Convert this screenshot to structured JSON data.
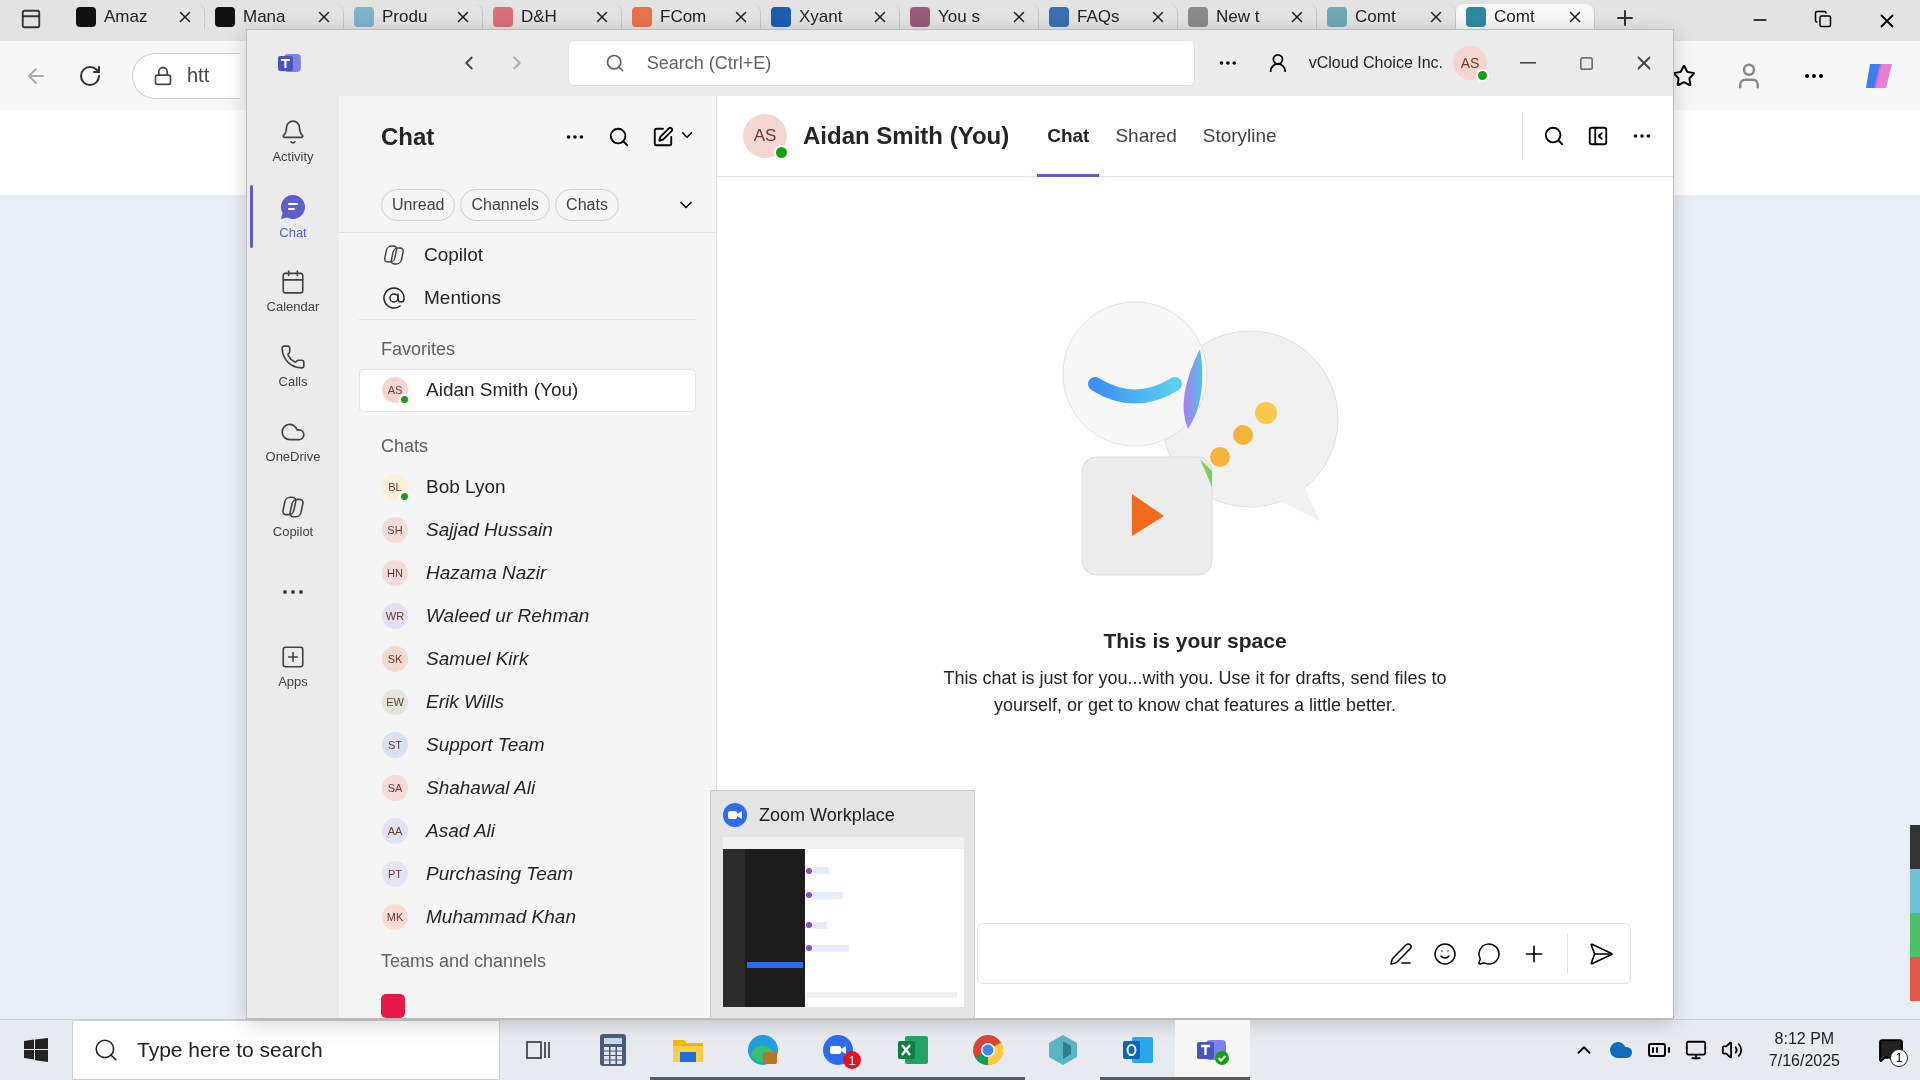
{
  "browser": {
    "tabs": [
      {
        "title": "Amaz",
        "color": "#111111",
        "selected": false
      },
      {
        "title": "Mana",
        "color": "#111111",
        "selected": false
      },
      {
        "title": "Produ",
        "color": "#7fb3c8",
        "selected": false
      },
      {
        "title": "D&H",
        "color": "#d9707a",
        "selected": false
      },
      {
        "title": "FCom",
        "color": "#e8734a",
        "selected": false
      },
      {
        "title": "Xyant",
        "color": "#1a5fb4",
        "selected": false
      },
      {
        "title": "You s",
        "color": "#9a5a7a",
        "selected": false
      },
      {
        "title": "FAQs",
        "color": "#3a70b0",
        "selected": false
      },
      {
        "title": "New t",
        "color": "#8a8a8a",
        "selected": false
      },
      {
        "title": "Comt",
        "color": "#6fa8b8",
        "selected": false
      },
      {
        "title": "Comt",
        "color": "#2f8aa0",
        "selected": true
      }
    ],
    "address": "htt"
  },
  "teams": {
    "title_bar": {
      "search_placeholder": "Search (Ctrl+E)",
      "organization": "vCloud Choice Inc.",
      "avatar": "AS"
    },
    "rail": [
      {
        "kind": "activity",
        "label": "Activity",
        "selected": false
      },
      {
        "kind": "chat",
        "label": "Chat",
        "selected": true
      },
      {
        "kind": "calendar",
        "label": "Calendar",
        "selected": false
      },
      {
        "kind": "calls",
        "label": "Calls",
        "selected": false
      },
      {
        "kind": "onedrive",
        "label": "OneDrive",
        "selected": false
      },
      {
        "kind": "copilot",
        "label": "Copilot",
        "selected": false
      },
      {
        "kind": "more",
        "selected": false
      },
      {
        "kind": "apps",
        "label": "Apps",
        "selected": false
      }
    ],
    "chat_list": {
      "title": "Chat",
      "filters": [
        "Unread",
        "Channels",
        "Chats"
      ],
      "quick_items": [
        {
          "kind": "copilot",
          "label": "Copilot"
        },
        {
          "kind": "mentions",
          "label": "Mentions"
        }
      ],
      "sections": [
        {
          "title": "Favorites",
          "items": [
            {
              "initials": "AS",
              "name": "Aidan Smith (You)",
              "color": "#f3d6cf",
              "online": true,
              "italic": false,
              "selected": true
            }
          ]
        },
        {
          "title": "Chats",
          "items": [
            {
              "initials": "BL",
              "name": "Bob Lyon",
              "color": "#fdefd9",
              "online": true,
              "italic": false,
              "selected": false
            },
            {
              "initials": "SH",
              "name": "Sajjad Hussain",
              "color": "#f5dada",
              "online": false,
              "italic": true,
              "selected": false
            },
            {
              "initials": "HN",
              "name": "Hazama Nazir",
              "color": "#f5dada",
              "online": false,
              "italic": true,
              "selected": false
            },
            {
              "initials": "WR",
              "name": "Waleed ur Rehman",
              "color": "#e1dff2",
              "online": false,
              "italic": true,
              "selected": false
            },
            {
              "initials": "SK",
              "name": "Samuel Kirk",
              "color": "#f5d8cc",
              "online": false,
              "italic": true,
              "selected": false
            },
            {
              "initials": "EW",
              "name": "Erik Wills",
              "color": "#e2e5dc",
              "online": false,
              "italic": true,
              "selected": false
            },
            {
              "initials": "ST",
              "name": "Support Team",
              "color": "#d7e1f3",
              "online": false,
              "italic": true,
              "selected": false
            },
            {
              "initials": "SA",
              "name": "Shahawal Ali",
              "color": "#f5dada",
              "online": false,
              "italic": true,
              "selected": false
            },
            {
              "initials": "AA",
              "name": "Asad Ali",
              "color": "#e3e2f2",
              "online": false,
              "italic": true,
              "selected": false
            },
            {
              "initials": "PT",
              "name": "Purchasing Team",
              "color": "#e6e4f3",
              "online": false,
              "italic": true,
              "selected": false
            },
            {
              "initials": "MK",
              "name": "Muhammad Khan",
              "color": "#fbdcd2",
              "online": false,
              "italic": true,
              "selected": false
            }
          ]
        },
        {
          "title": "Teams and channels",
          "items": [
            {
              "color": "#e8174a"
            }
          ]
        }
      ]
    },
    "conversation": {
      "avatar": "AS",
      "online": true,
      "name": "Aidan Smith (You)",
      "tabs": [
        {
          "label": "Chat",
          "selected": true
        },
        {
          "label": "Shared",
          "selected": false
        },
        {
          "label": "Storyline",
          "selected": false
        }
      ],
      "empty_title": "This is your space",
      "empty_text": "This chat is just for you...with you. Use it for drafts, send files to yourself, or get to know chat features a little better."
    }
  },
  "preview": {
    "title": "Zoom Workplace"
  },
  "taskbar": {
    "search_placeholder": "Type here to search",
    "apps": [
      {
        "kind": "taskview",
        "running": false,
        "active": false
      },
      {
        "kind": "calculator",
        "running": false,
        "active": false
      },
      {
        "kind": "folder",
        "running": true,
        "active": false
      },
      {
        "kind": "edge",
        "running": true,
        "active": false
      },
      {
        "kind": "zoom",
        "running": true,
        "active": false,
        "badge": "1"
      },
      {
        "kind": "excel",
        "running": true,
        "active": false
      },
      {
        "kind": "chrome",
        "running": true,
        "active": false
      },
      {
        "kind": "diamond",
        "running": false,
        "active": false
      },
      {
        "kind": "outlook",
        "running": true,
        "active": false
      },
      {
        "kind": "teams",
        "running": true,
        "active": true
      }
    ],
    "time": "8:12 PM",
    "date": "7/16/2025",
    "notifications": "1"
  }
}
